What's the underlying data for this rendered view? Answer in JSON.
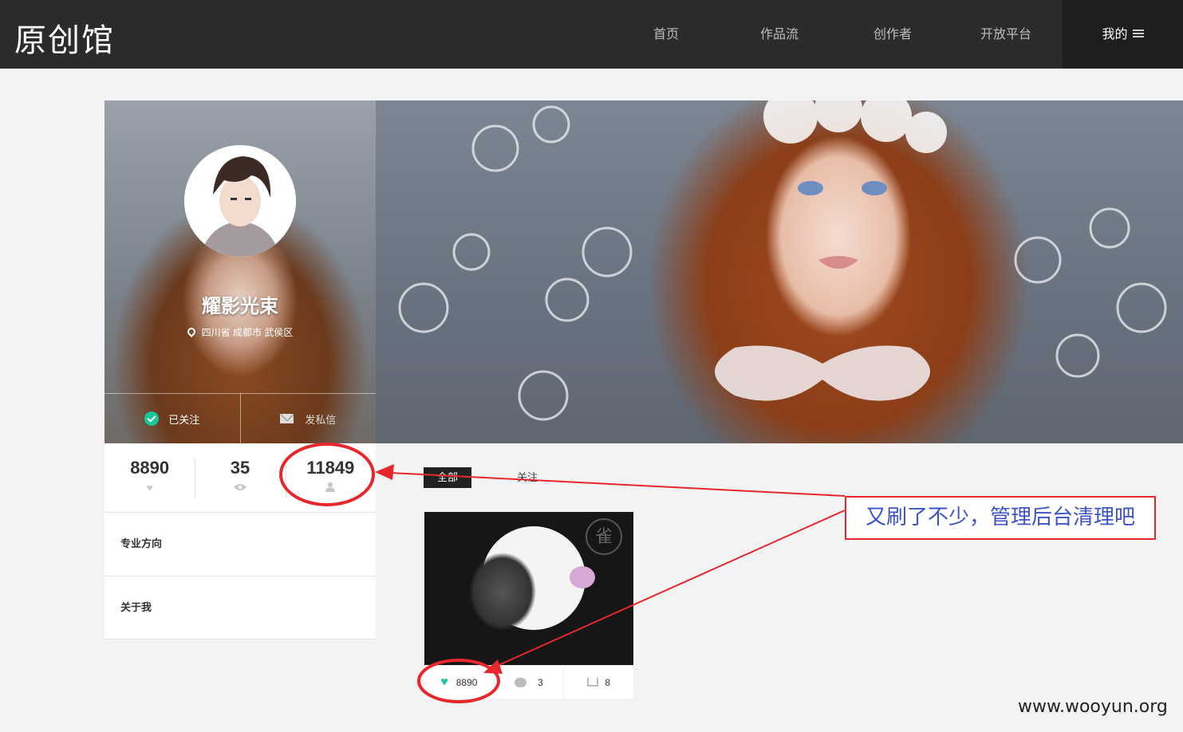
{
  "header": {
    "logo": "原创馆",
    "nav": [
      "首页",
      "作品流",
      "创作者",
      "开放平台"
    ],
    "mine": "我的"
  },
  "profile": {
    "name": "耀影光束",
    "location": "四川省 成都市 武侯区",
    "follow_label": "已关注",
    "message_label": "发私信",
    "stats": {
      "likes": "8890",
      "views": "35",
      "followers": "11849"
    },
    "sections": [
      "专业方向",
      "关于我"
    ]
  },
  "tabs": {
    "all": "全部",
    "follow": "关注"
  },
  "artwork": {
    "seal": "雀",
    "likes": "8890",
    "comments": "3",
    "shares": "8"
  },
  "annotation": {
    "text": "又刷了不少，管理后台清理吧",
    "color": "#e8272d",
    "text_color": "#3c52c7"
  },
  "watermark": "www.wooyun.org"
}
